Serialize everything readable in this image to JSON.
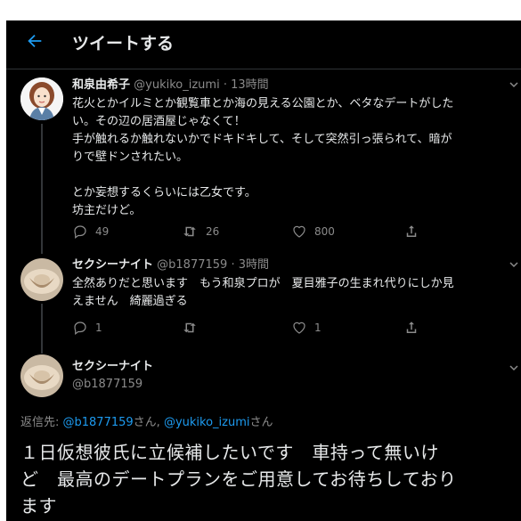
{
  "header": {
    "title": "ツイートする"
  },
  "tweets": [
    {
      "name": "和泉由希子",
      "handle": "@yukiko_izumi",
      "sep": "·",
      "time": "13時間",
      "lines": [
        "花火とかイルミとか観覧車とか海の見える公園とか、ベタなデートがした",
        "い。その辺の居酒屋じゃなくて！",
        "手が触れるか触れないかでドキドキして、そして突然引っ張られて、暗が",
        "りで壁ドンされたい。",
        "",
        "とか妄想するくらいには乙女です。",
        "坊主だけど。"
      ],
      "replies": "49",
      "retweets": "26",
      "likes": "800"
    },
    {
      "name": "セクシーナイト",
      "handle": "@b1877159",
      "sep": "·",
      "time": "3時間",
      "lines": [
        "全然ありだと思います　もう和泉プロが　夏目雅子の生まれ代りにしか見",
        "えません　綺麗過ぎる"
      ],
      "replies": "1",
      "retweets": "",
      "likes": "1"
    }
  ],
  "composer": {
    "name": "セクシーナイト",
    "handle": "@b1877159",
    "reply_prefix": "返信先: ",
    "reply_user1": "@b1877159",
    "reply_mid": "さん, ",
    "reply_user2": "@yukiko_izumi",
    "reply_suffix": "さん",
    "text_lines": [
      "１日仮想彼氏に立候補したいです　車持って無いけ",
      "ど　最高のデートプランをご用意してお待ちしており",
      "ます"
    ]
  },
  "colors": {
    "accent": "#1d9bf0",
    "background": "#000000",
    "muted": "#8b8b8b"
  },
  "icons": [
    "back-arrow-icon",
    "reply-icon",
    "retweet-icon",
    "like-icon",
    "share-icon",
    "more-chevron-icon"
  ]
}
